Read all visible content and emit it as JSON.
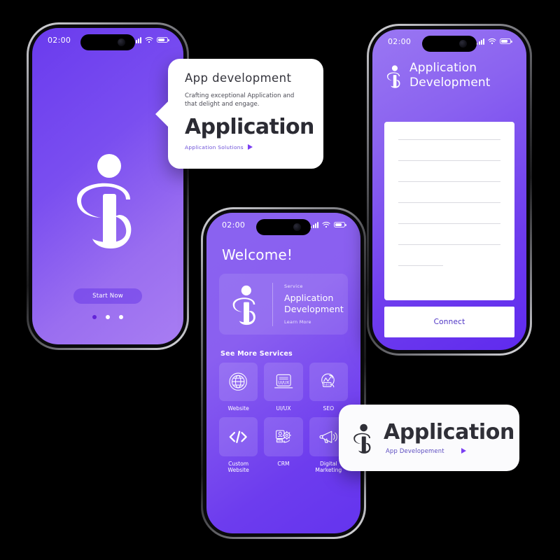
{
  "brand": {
    "logo_icon": "person-i-logo-icon"
  },
  "phone_splash": {
    "name": "splash-screen",
    "status": {
      "clock": "02:00",
      "signal_icon": "cellular-bars-icon",
      "wifi_icon": "wifi-icon",
      "battery_icon": "battery-icon"
    },
    "logo_icon": "person-i-logo-icon",
    "start_button": "Start Now",
    "pagination": {
      "count": 3,
      "active_index": 0
    }
  },
  "callout_card": {
    "name": "app-development-callout",
    "title": "App development",
    "subtitle": "Crafting exceptional Application and that delight and engage.",
    "headline": "Application",
    "footer_label": "Application  Solutions",
    "footer_icon": "play-triangle-icon"
  },
  "phone_home": {
    "name": "home-screen",
    "status": {
      "clock": "02:00",
      "signal_icon": "cellular-bars-icon",
      "wifi_icon": "wifi-icon",
      "battery_icon": "battery-icon"
    },
    "welcome": "Welcome!",
    "service_card": {
      "logo_icon": "person-i-logo-icon",
      "eyebrow": "Service",
      "title_line1": "Application",
      "title_line2": "Development",
      "link": "Learn More"
    },
    "section_title": "See More Services",
    "services": [
      {
        "label": "Website",
        "icon": "globe-icon"
      },
      {
        "label": "UI/UX",
        "icon": "laptop-uiux-icon"
      },
      {
        "label": "SEO",
        "icon": "seo-growth-chart-icon"
      },
      {
        "label": "Custom\nWebsite",
        "icon": "code-brackets-icon"
      },
      {
        "label": "CRM",
        "icon": "crm-gear-person-icon"
      },
      {
        "label": "Digital\nMarketing",
        "icon": "megaphone-icon"
      }
    ]
  },
  "phone_form": {
    "name": "application-development-form-screen",
    "status": {
      "clock": "02:00",
      "signal_icon": "cellular-bars-icon",
      "wifi_icon": "wifi-icon",
      "battery_icon": "battery-icon"
    },
    "logo_icon": "person-i-logo-icon",
    "heading_line1": "Application",
    "heading_line2": "Development",
    "form_lines": 7,
    "connect_button": "Connect"
  },
  "brand_card": {
    "name": "application-brand-card",
    "logo_icon": "person-i-logo-icon",
    "title": "Application",
    "subtitle": "App Developement",
    "arrow_icon": "play-triangle-icon"
  },
  "colors": {
    "purple_dark": "#6a3bee",
    "purple_light": "#a87df2",
    "accent": "#7b3ff2",
    "connect_text": "#4b31c4",
    "card_bg": "#ffffff",
    "page_bg": "#000000"
  }
}
